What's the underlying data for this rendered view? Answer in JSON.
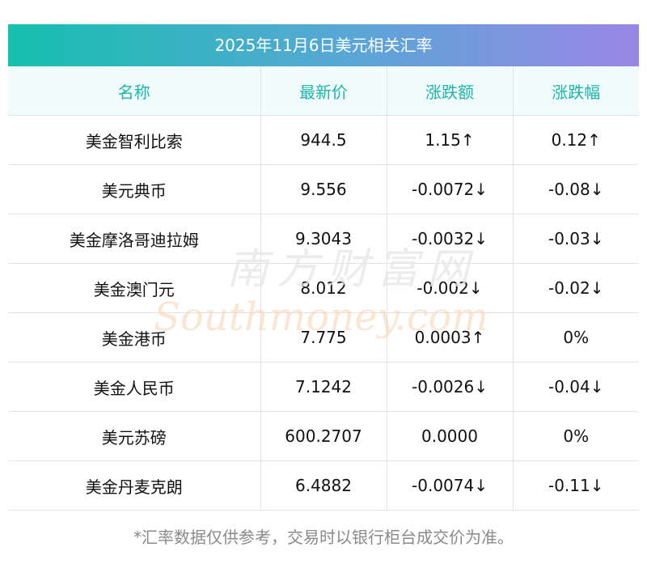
{
  "title": "2025年11月6日美元相关汇率",
  "headers": [
    "名称",
    "最新价",
    "涨跌额",
    "涨跌幅"
  ],
  "rows": [
    {
      "name": "美金智利比索",
      "price": "944.5",
      "change": "1.15↑",
      "pct": "0.12↑",
      "trend": "up",
      "pct_trend": "up"
    },
    {
      "name": "美元典币",
      "price": "9.556",
      "change": "-0.0072↓",
      "pct": "-0.08↓",
      "trend": "down",
      "pct_trend": "down"
    },
    {
      "name": "美金摩洛哥迪拉姆",
      "price": "9.3043",
      "change": "-0.0032↓",
      "pct": "-0.03↓",
      "trend": "down",
      "pct_trend": "down"
    },
    {
      "name": "美金澳门元",
      "price": "8.012",
      "change": "-0.002↓",
      "pct": "-0.02↓",
      "trend": "down",
      "pct_trend": "down"
    },
    {
      "name": "美金港币",
      "price": "7.775",
      "change": "0.0003↑",
      "pct": "0%",
      "trend": "flat",
      "change_trend": "up",
      "pct_trend": "flat"
    },
    {
      "name": "美金人民币",
      "price": "7.1242",
      "change": "-0.0026↓",
      "pct": "-0.04↓",
      "trend": "down",
      "pct_trend": "down"
    },
    {
      "name": "美元苏磅",
      "price": "600.2707",
      "change": "0.0000",
      "pct": "0%",
      "trend": "flat",
      "change_trend": "flat",
      "pct_trend": "flat"
    },
    {
      "name": "美金丹麦克朗",
      "price": "6.4882",
      "change": "-0.0074↓",
      "pct": "-0.11↓",
      "trend": "down",
      "pct_trend": "down"
    }
  ],
  "watermark": {
    "brand": "南方财富网",
    "domain": "Southmoney.com"
  },
  "footnote": "*汇率数据仅供参考，交易时以银行柜台成交价为准。",
  "colors": {
    "up": "#e8141b",
    "down": "#138a13",
    "header_text": "#1db5a9"
  }
}
